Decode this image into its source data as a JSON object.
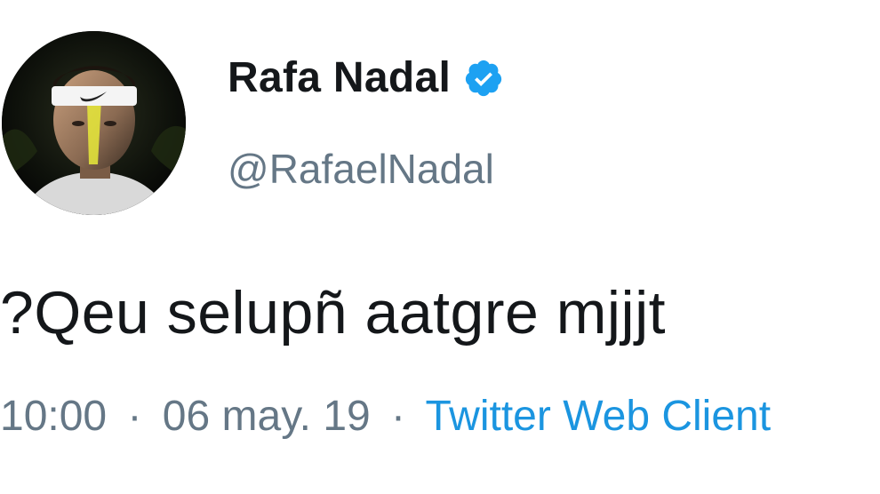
{
  "user": {
    "display_name": "Rafa Nadal",
    "handle": "@RafaelNadal",
    "verified": true,
    "verified_badge_icon": "verified-check-icon",
    "verified_color": "#1da1f2"
  },
  "tweet": {
    "text": "?Qeu selupñ aatgre mjjjt",
    "time": "10:00",
    "separator": "·",
    "date": "06 may. 19",
    "source": "Twitter Web Client"
  },
  "colors": {
    "text": "#14171a",
    "secondary": "#657786",
    "link": "#1b95e0"
  }
}
